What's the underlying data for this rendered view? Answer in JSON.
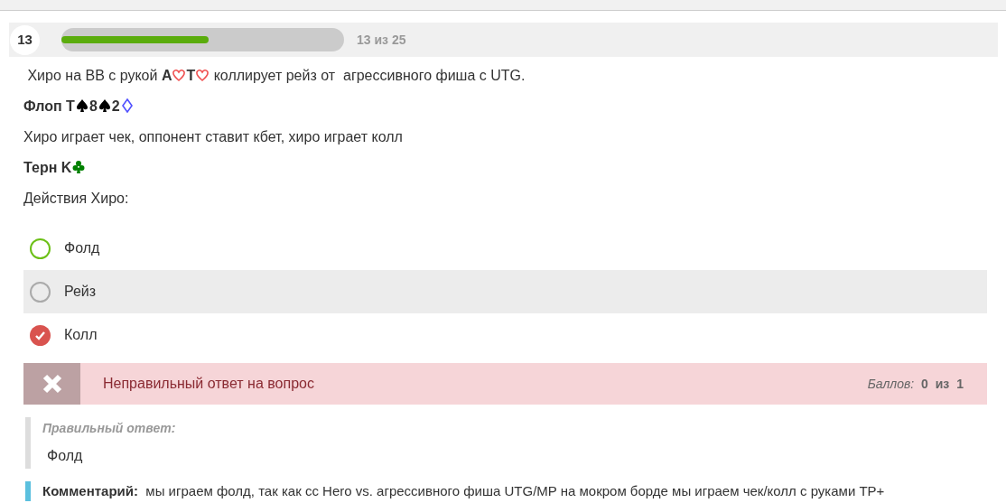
{
  "progress": {
    "number": "13",
    "level": 0.52,
    "label": "13 из 25"
  },
  "question": [
    {
      "parts": [
        {
          "kind": "text",
          "text": " Хиро на BB с рукой "
        },
        {
          "kind": "text",
          "text": "A",
          "bold": true
        },
        {
          "kind": "heart",
          "color": "#f05050"
        },
        {
          "kind": "text",
          "text": "T",
          "bold": true
        },
        {
          "kind": "heart",
          "color": "#f05050"
        },
        {
          "kind": "text",
          "text": " коллирует рейз от  агрессивного фиша с UTG."
        }
      ]
    },
    {
      "parts": [
        {
          "kind": "text",
          "text": "Флоп T",
          "bold": true
        },
        {
          "kind": "spade",
          "color": "#000000"
        },
        {
          "kind": "text",
          "text": "8",
          "bold": true
        },
        {
          "kind": "spade",
          "color": "#000000"
        },
        {
          "kind": "text",
          "text": "2",
          "bold": true
        },
        {
          "kind": "diamond",
          "color": "#5050ff"
        }
      ]
    },
    {
      "parts": [
        {
          "kind": "text",
          "text": "Хиро играет чек, оппонент ставит кбет, хиро играет колл"
        }
      ]
    },
    {
      "parts": [
        {
          "kind": "text",
          "text": "Терн K",
          "bold": true
        },
        {
          "kind": "club",
          "color": "#008000"
        }
      ]
    },
    {
      "parts": [
        {
          "kind": "text",
          "text": "Действия Хиро:"
        }
      ]
    }
  ],
  "answers": [
    {
      "label": "Фолд",
      "selected": false,
      "correct": true,
      "highlighted": false
    },
    {
      "label": "Рейз",
      "selected": false,
      "correct": false,
      "highlighted": true
    },
    {
      "label": "Колл",
      "selected": true,
      "correct": false,
      "highlighted": false
    }
  ],
  "feedback": {
    "message": "Неправильный ответ на вопрос",
    "score_label": "Баллов:",
    "score": "0",
    "of": "из",
    "max": "1"
  },
  "correct_answer": {
    "title": "Правильный ответ:",
    "value": "Фолд"
  },
  "comment": {
    "label": "Комментарий:",
    "text": "  мы играем фолд, так как сс Hero vs. агрессивного фиша UTG/MP на мокром борде мы играем чек/колл с руками TP+"
  }
}
